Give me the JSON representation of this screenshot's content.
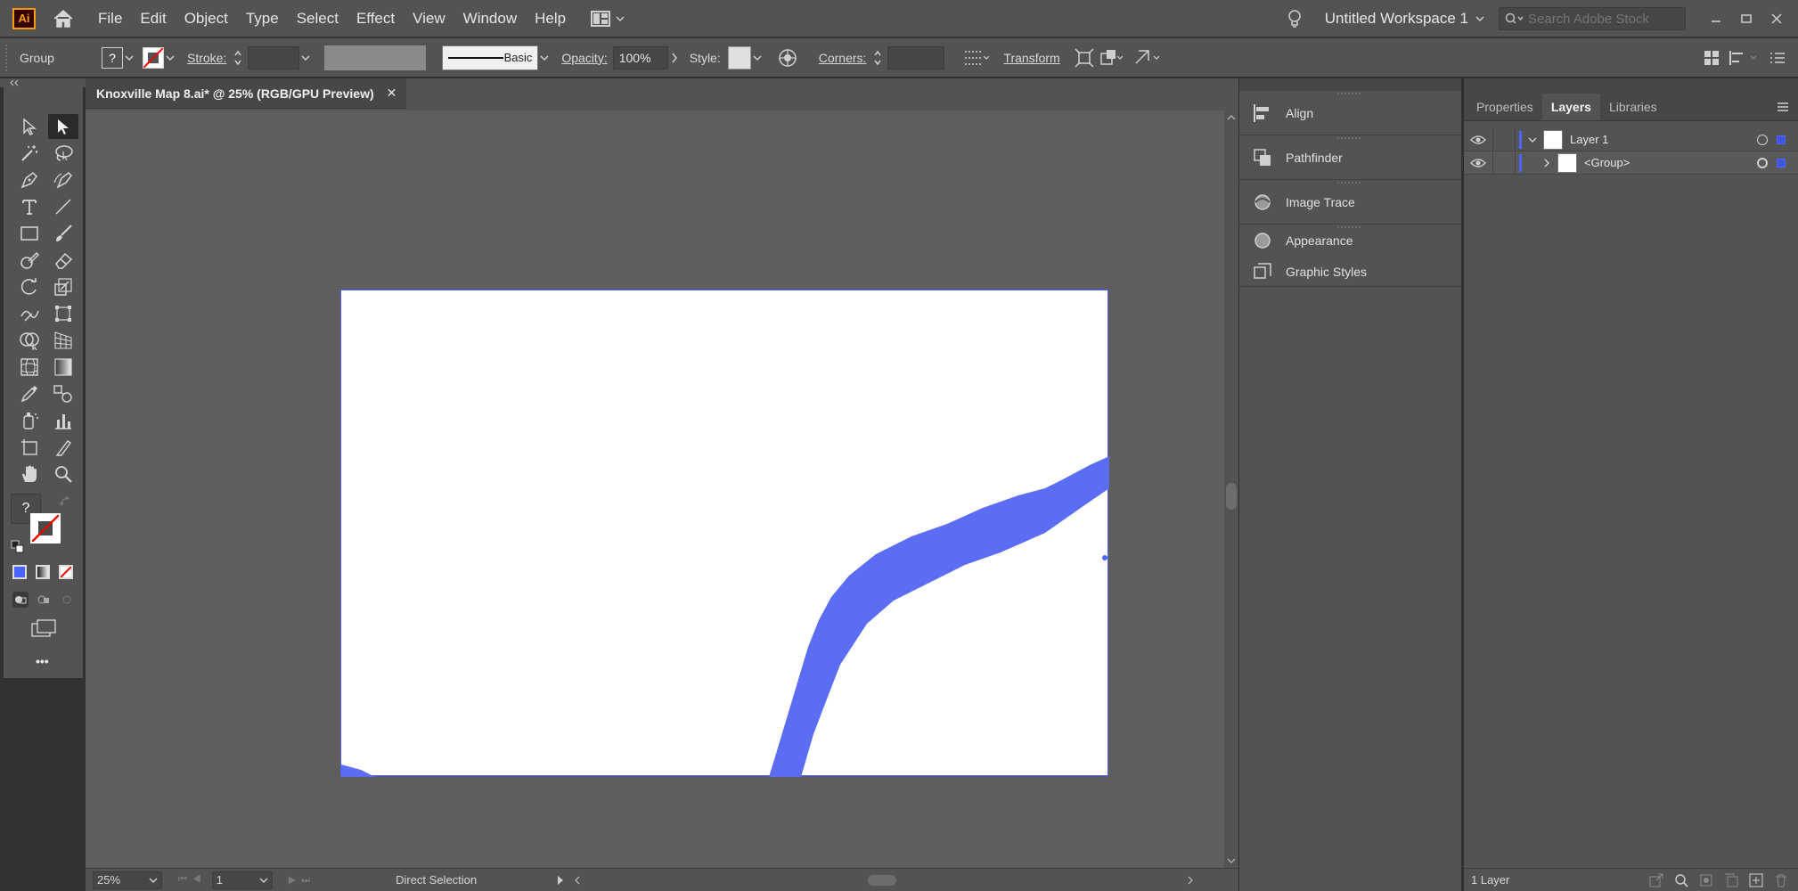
{
  "app": {
    "logo_text": "Ai",
    "menu": [
      "File",
      "Edit",
      "Object",
      "Type",
      "Select",
      "Effect",
      "View",
      "Window",
      "Help"
    ],
    "workspace": "Untitled Workspace 1",
    "search_placeholder": "Search Adobe Stock"
  },
  "control_bar": {
    "selection_label": "Group",
    "fill_symbol": "?",
    "stroke_label": "Stroke:",
    "stroke_style": "Basic",
    "opacity_label": "Opacity:",
    "opacity_value": "100%",
    "style_label": "Style:",
    "corners_label": "Corners:",
    "transform_label": "Transform"
  },
  "toolbar": {
    "tools": [
      "selection-tool",
      "direct-selection-tool",
      "magic-wand-tool",
      "lasso-tool",
      "pen-tool",
      "curvature-tool",
      "type-tool",
      "line-segment-tool",
      "rectangle-tool",
      "paintbrush-tool",
      "shaper-tool",
      "eraser-tool",
      "rotate-tool",
      "scale-tool",
      "puppet-warp-tool",
      "free-transform-tool",
      "shape-builder-tool",
      "perspective-grid-tool",
      "mesh-tool",
      "gradient-tool",
      "eyedropper-tool",
      "blend-tool",
      "symbol-sprayer-tool",
      "column-graph-tool",
      "artboard-tool",
      "slice-tool",
      "hand-tool",
      "zoom-tool"
    ],
    "active_tool": "direct-selection-tool",
    "unknown_symbol": "?",
    "more_label": "•••"
  },
  "document": {
    "tab_title": "Knoxville Map 8.ai* @ 25% (RGB/GPU Preview)",
    "close_symbol": "✕",
    "zoom": "25%",
    "artboard_number": "1",
    "current_tool": "Direct Selection",
    "selection_color": "#4c64ff",
    "river_color": "#5b6cf5"
  },
  "mid_panels": [
    "Align",
    "Pathfinder",
    "Image Trace",
    "Appearance",
    "Graphic Styles"
  ],
  "right_panel": {
    "tabs": [
      "Properties",
      "Layers",
      "Libraries"
    ],
    "active_tab": "Layers",
    "layers": [
      {
        "name": "Layer 1",
        "expanded": true
      },
      {
        "name": "<Group>",
        "expanded": false
      }
    ],
    "footer_count": "1 Layer"
  }
}
